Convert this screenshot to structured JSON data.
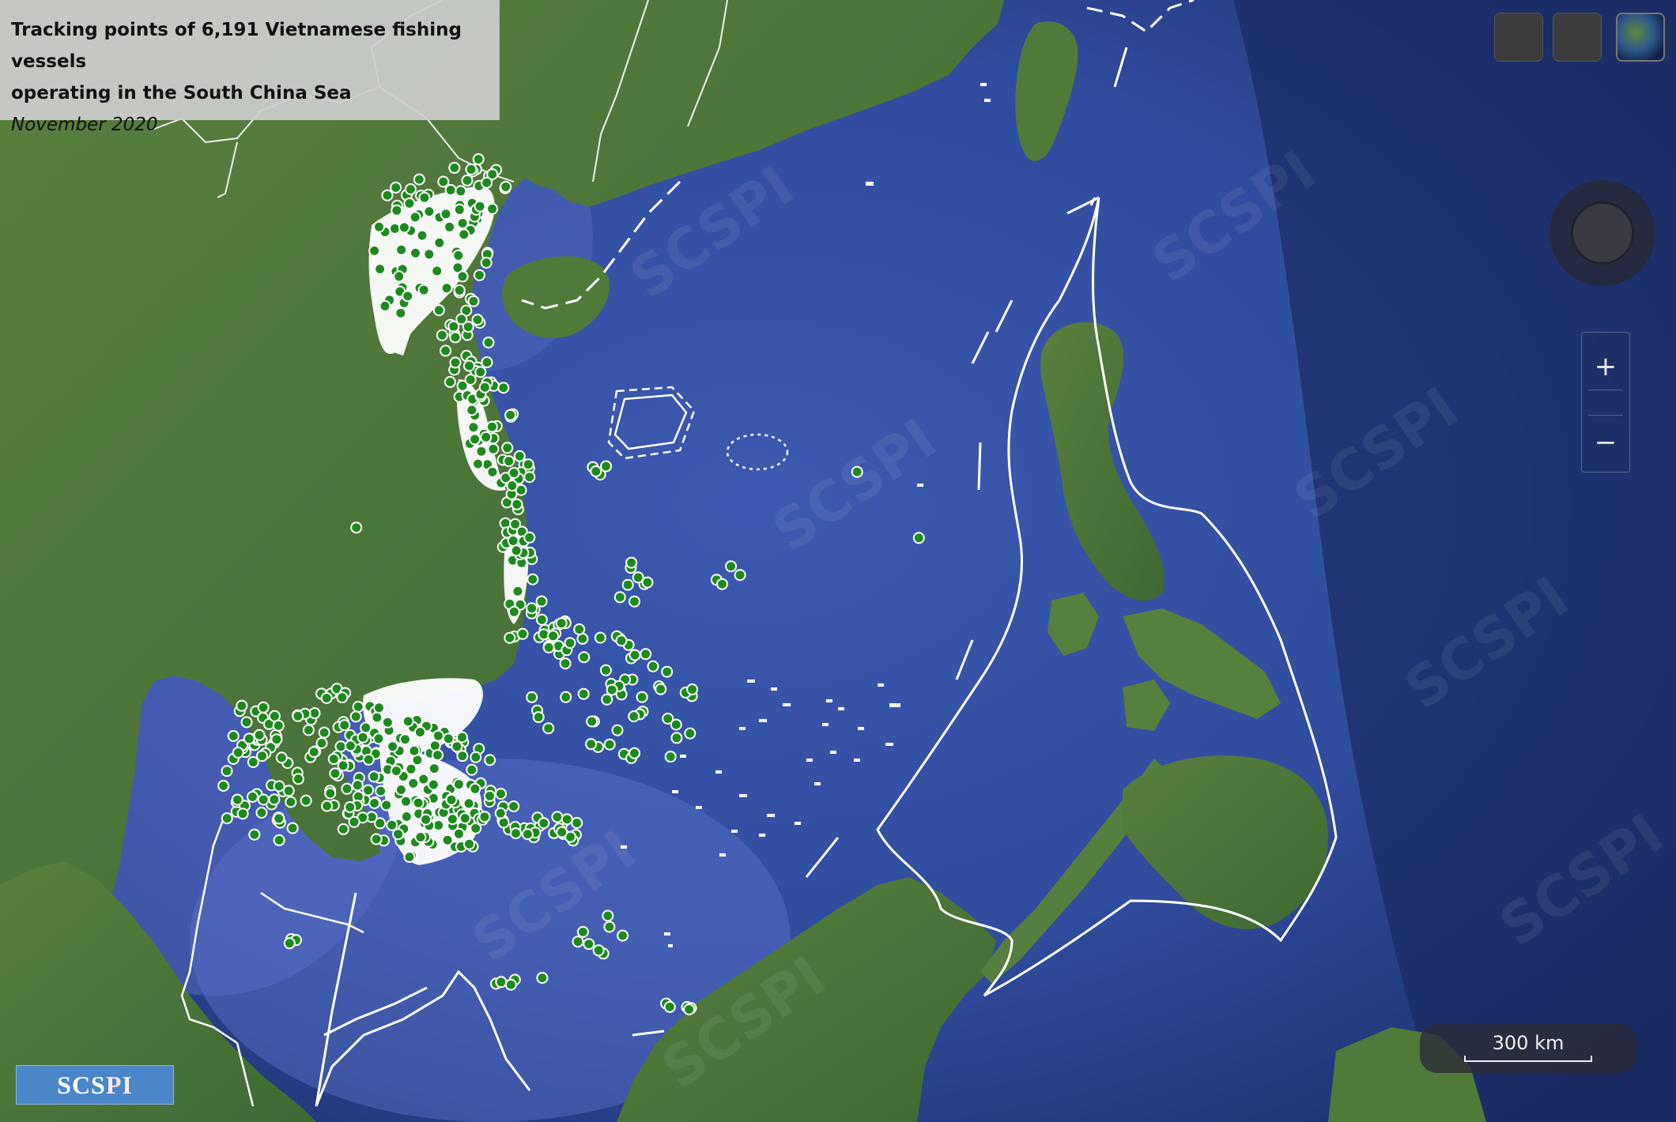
{
  "title": {
    "line1": "Tracking points of 6,191 Vietnamese fishing vessels",
    "line2": "operating in the South China Sea",
    "date": "November 2020"
  },
  "controls": {
    "zoom_in": "+",
    "zoom_out": "−",
    "top_buttons": [
      "layer-toggle",
      "basemap-toggle",
      "globe"
    ]
  },
  "scale": {
    "label": "300 km"
  },
  "logo": {
    "text_main": "SCS",
    "text_accent": "PI"
  },
  "watermark": {
    "text": "SCSPI"
  },
  "colors": {
    "vessel_point": "#1e8a1e",
    "vessel_outline": "#ffffff",
    "dense_track": "#ffffff",
    "boundary": "#ffffff",
    "sea": "#2c4a9c",
    "land": "#4f7a3c"
  },
  "vessel_count": 6191
}
